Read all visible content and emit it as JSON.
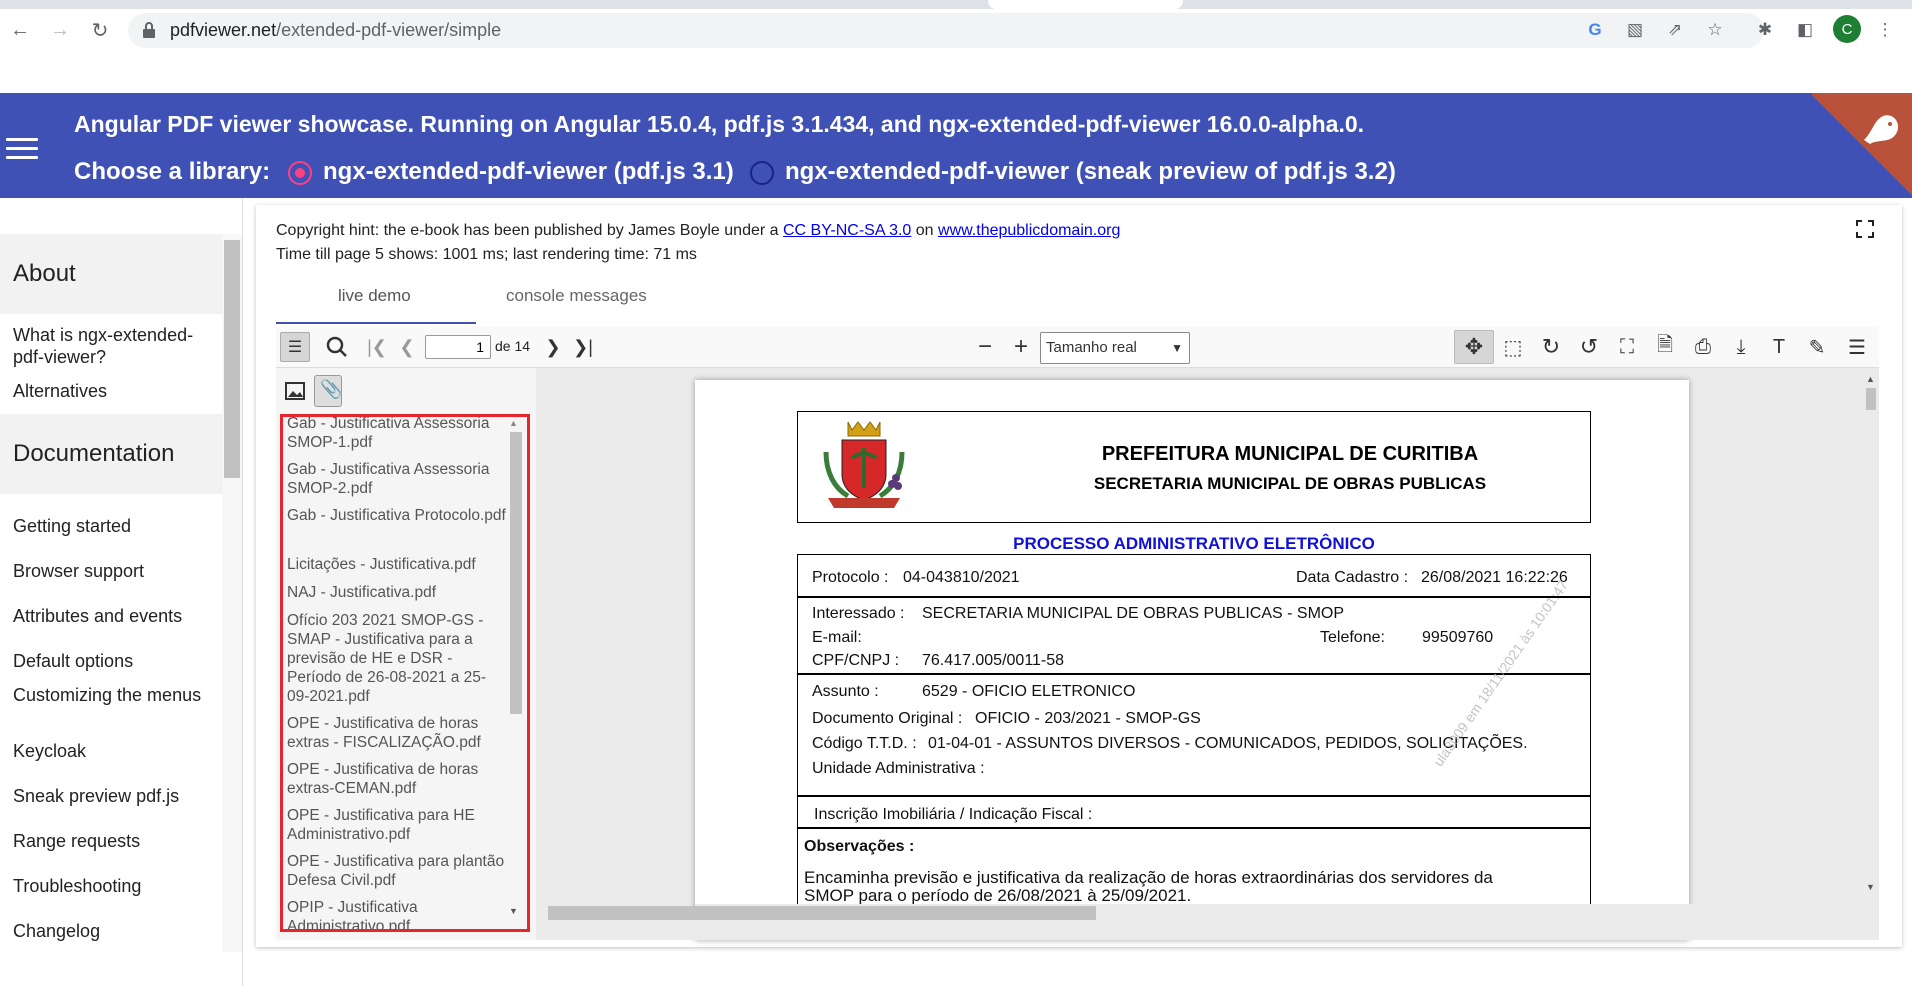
{
  "browser": {
    "url_domain": "pdfviewer.net",
    "url_path": "/extended-pdf-viewer/simple",
    "profile_initial": "C"
  },
  "header": {
    "title": "Angular PDF viewer showcase. Running on Angular 15.0.4, pdf.js 3.1.434, and ngx-extended-pdf-viewer 16.0.0-alpha.0.",
    "choose_label": "Choose a library:",
    "options": [
      {
        "label": "ngx-extended-pdf-viewer (pdf.js 3.1)",
        "selected": true
      },
      {
        "label": "ngx-extended-pdf-viewer (sneak preview of pdf.js 3.2)",
        "selected": false
      }
    ],
    "accent": "#3f51b5",
    "radio_color": "#ff4081"
  },
  "sidebar": {
    "about": "About",
    "about_items": [
      "What is ngx-extended-pdf-viewer?",
      "Alternatives"
    ],
    "documentation": "Documentation",
    "doc_items": [
      "Getting started",
      "Browser support",
      "Attributes and events",
      "Default options",
      "Customizing the menus",
      "Keycloak",
      "Sneak preview pdf.js",
      "Range requests",
      "Troubleshooting",
      "Changelog"
    ]
  },
  "main": {
    "copyright_prefix": "Copyright hint: the e-book has been published by James Boyle under a ",
    "license_link": "CC BY-NC-SA 3.0",
    "copyright_mid": " on ",
    "domain_link": "www.thepublicdomain.org",
    "timing": "Time till page 5 shows: 1001 ms; last rendering time: 71 ms",
    "tabs": [
      "live demo",
      "console messages"
    ]
  },
  "pdf_toolbar": {
    "page_value": "1",
    "page_of": "de 14",
    "zoom": "Tamanho real"
  },
  "attachments": [
    "Gab - Justificativa Assessoria SMOP-1.pdf",
    "Gab - Justificativa Assessoria SMOP-2.pdf",
    "Gab - Justificativa Protocolo.pdf",
    "Licitações - Justificativa.pdf",
    "NAJ - Justificativa.pdf",
    "Ofício 203 2021 SMOP-GS - SMAP - Justificativa para a previsão de HE e DSR - Período de 26-08-2021 a 25-09-2021.pdf",
    "OPE - Justificativa de horas extras - FISCALIZAÇÃO.pdf",
    "OPE - Justificativa de horas extras-CEMAN.pdf",
    "OPE - Justificativa para HE Administrativo.pdf",
    "OPE - Justificativa para plantão Defesa Civil.pdf",
    "OPIP - Justificativa Administrativo.pdf"
  ],
  "document": {
    "org1": "PREFEITURA MUNICIPAL DE CURITIBA",
    "org2": "SECRETARIA MUNICIPAL DE OBRAS PUBLICAS",
    "process_title": "PROCESSO ADMINISTRATIVO ELETRÔNICO",
    "protocolo_label": "Protocolo :",
    "protocolo_value": "04-043810/2021",
    "data_cadastro_label": "Data Cadastro :",
    "data_cadastro_value": "26/08/2021 16:22:26",
    "interessado_label": "Interessado :",
    "interessado_value": "SECRETARIA MUNICIPAL DE OBRAS PUBLICAS - SMOP",
    "email_label": "E-mail:",
    "telefone_label": "Telefone:",
    "telefone_value": "99509760",
    "cpf_label": "CPF/CNPJ :",
    "cpf_value": "76.417.005/0011-58",
    "assunto_label": "Assunto :",
    "assunto_value": "6529 - OFICIO ELETRONICO",
    "doc_original_label": "Documento Original :",
    "doc_original_value": "OFICIO - 203/2021 - SMOP-GS",
    "codigo_label": "Código T.T.D. :",
    "codigo_value": "01-04-01 - ASSUNTOS DIVERSOS - COMUNICADOS, PEDIDOS, SOLICITAÇÕES.",
    "unidade_label": "Unidade Administrativa :",
    "inscricao_label": "Inscrição Imobiliária / Indicação Fiscal :",
    "observacoes_label": "Observações :",
    "observacoes_text1": "Encaminha previsão e justificativa da realização de horas extraordinárias dos servidores da",
    "observacoes_text2": "SMOP para o período de 26/08/2021 à 25/09/2021.",
    "watermark": "ula3009 em 18/11/2021 às 10:01:47"
  }
}
